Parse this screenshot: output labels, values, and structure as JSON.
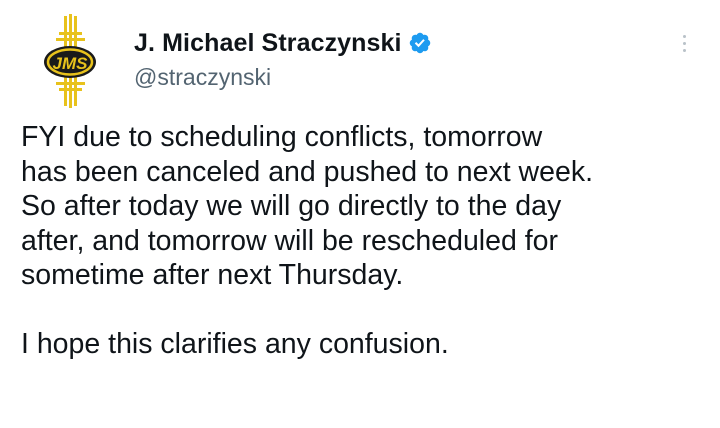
{
  "author": {
    "display_name": "J. Michael Straczynski",
    "handle": "@straczynski",
    "verified": true,
    "avatar_icon": "jms-logo-icon",
    "avatar_text": "JMS"
  },
  "menu": {
    "icon": "more-options-icon"
  },
  "tweet": {
    "lines": [
      "FYI due to scheduling conflicts, tomorrow",
      "has been canceled and pushed to next week.",
      "So after today we will go directly to the day",
      "after, and tomorrow will be rescheduled for",
      "sometime after next Thursday."
    ],
    "closing": "I hope this clarifies any confusion."
  },
  "colors": {
    "text": "#0f1419",
    "handle": "#536471",
    "verified": "#1d9bf0",
    "logo_gold": "#e8c21c",
    "logo_dark": "#1a1a1a"
  }
}
